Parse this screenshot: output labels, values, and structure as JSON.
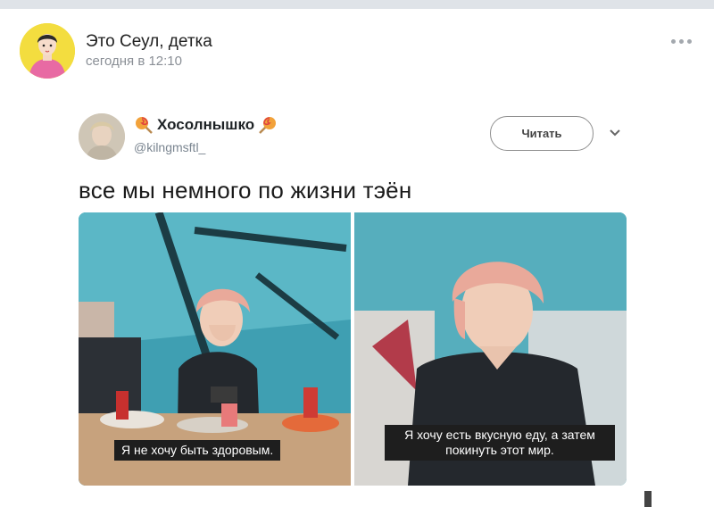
{
  "post": {
    "group_name": "Это Сеул, детка",
    "time": "сегодня в 12:10"
  },
  "tweet": {
    "display_name": "Хосолнышко",
    "handle": "@kilngmsftl_",
    "follow_label": "Читать",
    "text": "все мы немного по жизни тэён"
  },
  "media": {
    "left_subtitle": "Я не хочу быть здоровым.",
    "right_subtitle": "Я хочу есть вкусную еду, а затем покинуть этот мир."
  },
  "icons": {
    "more": "more-horizontal-icon",
    "chevron": "chevron-down-icon",
    "lollipop": "lollipop-icon"
  },
  "colors": {
    "group_avatar_bg": "#f3dd3f",
    "teal_bg": "#3f9fb2",
    "hair": "#e9a99a"
  }
}
